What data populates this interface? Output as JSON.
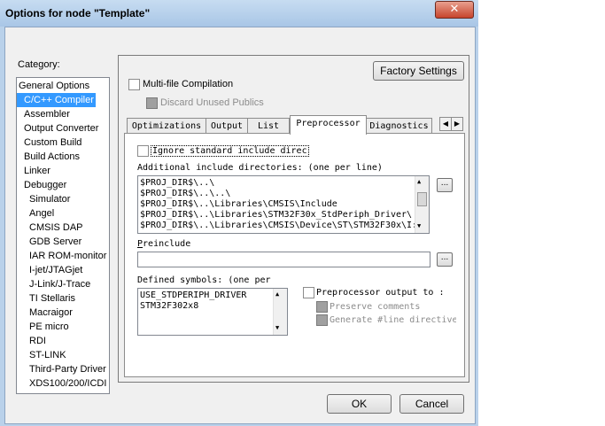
{
  "window": {
    "title": "Options for node \"Template\"",
    "close_glyph": "✕"
  },
  "category": {
    "label": "Category:",
    "items": [
      "General Options",
      "C/C++ Compiler",
      "Assembler",
      "Output Converter",
      "Custom Build",
      "Build Actions",
      "Linker",
      "Debugger",
      "Simulator",
      "Angel",
      "CMSIS DAP",
      "GDB Server",
      "IAR ROM-monitor",
      "I-jet/JTAGjet",
      "J-Link/J-Trace",
      "TI Stellaris",
      "Macraigor",
      "PE micro",
      "RDI",
      "ST-LINK",
      "Third-Party Driver",
      "XDS100/200/ICDI"
    ],
    "selected": "C/C++ Compiler"
  },
  "buttons": {
    "factory_settings": "Factory Settings",
    "ok": "OK",
    "cancel": "Cancel",
    "browse": "..."
  },
  "options": {
    "multi_file": "Multi-file Compilation",
    "discard_unused": "Discard Unused Publics"
  },
  "tabs": [
    "Optimizations",
    "Output",
    "List",
    "Preprocessor",
    "Diagnostics"
  ],
  "active_tab": "Preprocessor",
  "preprocessor": {
    "ignore_std_include": "Ignore standard include direc",
    "additional_include_label": "Additional include directories: (one per line)",
    "include_dirs": [
      "$PROJ_DIR$\\..\\",
      "$PROJ_DIR$\\..\\..\\",
      "$PROJ_DIR$\\..\\Libraries\\CMSIS\\Include",
      "$PROJ_DIR$\\..\\Libraries\\STM32F30x_StdPeriph_Driver\\",
      "$PROJ_DIR$\\..\\Libraries\\CMSIS\\Device\\ST\\STM32F30x\\I:"
    ],
    "preinclude_label": "Preinclude",
    "preinclude_value": "",
    "defined_symbols_label": "Defined symbols: (one per",
    "defined_symbols": [
      "USE_STDPERIPH_DRIVER",
      "STM32F302x8"
    ],
    "preprocessor_output": "Preprocessor output to :",
    "preserve_comments": "Preserve comments",
    "generate_line": "Generate #line directive"
  }
}
